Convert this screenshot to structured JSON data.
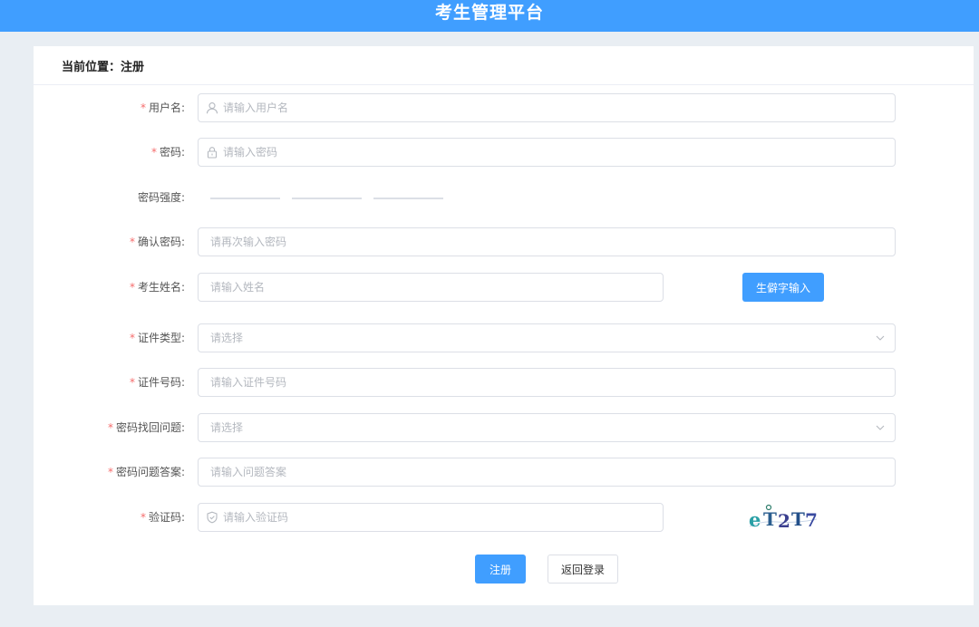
{
  "header": {
    "title": "考生管理平台"
  },
  "breadcrumb": {
    "text": "当前位置：注册"
  },
  "form": {
    "username": {
      "label": "用户名:",
      "placeholder": "请输入用户名",
      "value": ""
    },
    "password": {
      "label": "密码:",
      "placeholder": "请输入密码",
      "value": ""
    },
    "strength": {
      "label": "密码强度:",
      "level": 0
    },
    "confirm_password": {
      "label": "确认密码:",
      "placeholder": "请再次输入密码",
      "value": ""
    },
    "name": {
      "label": "考生姓名:",
      "placeholder": "请输入姓名",
      "value": "",
      "rare_char_button": "生僻字输入"
    },
    "id_type": {
      "label": "证件类型:",
      "placeholder": "请选择",
      "value": ""
    },
    "id_number": {
      "label": "证件号码:",
      "placeholder": "请输入证件号码",
      "value": ""
    },
    "security_question": {
      "label": "密码找回问题:",
      "placeholder": "请选择",
      "value": ""
    },
    "security_answer": {
      "label": "密码问题答案:",
      "placeholder": "请输入问题答案",
      "value": ""
    },
    "captcha": {
      "label": "验证码:",
      "placeholder": "请输入验证码",
      "value": "",
      "image_text": "eT2T7"
    }
  },
  "actions": {
    "register": "注册",
    "back_to_login": "返回登录"
  },
  "icons": {
    "username": "user-icon",
    "password": "lock-icon",
    "captcha": "shield-icon",
    "select": "chevron-down-icon"
  },
  "colors": {
    "primary": "#409eff",
    "required": "#f56c6c",
    "background": "#e9eef3"
  }
}
